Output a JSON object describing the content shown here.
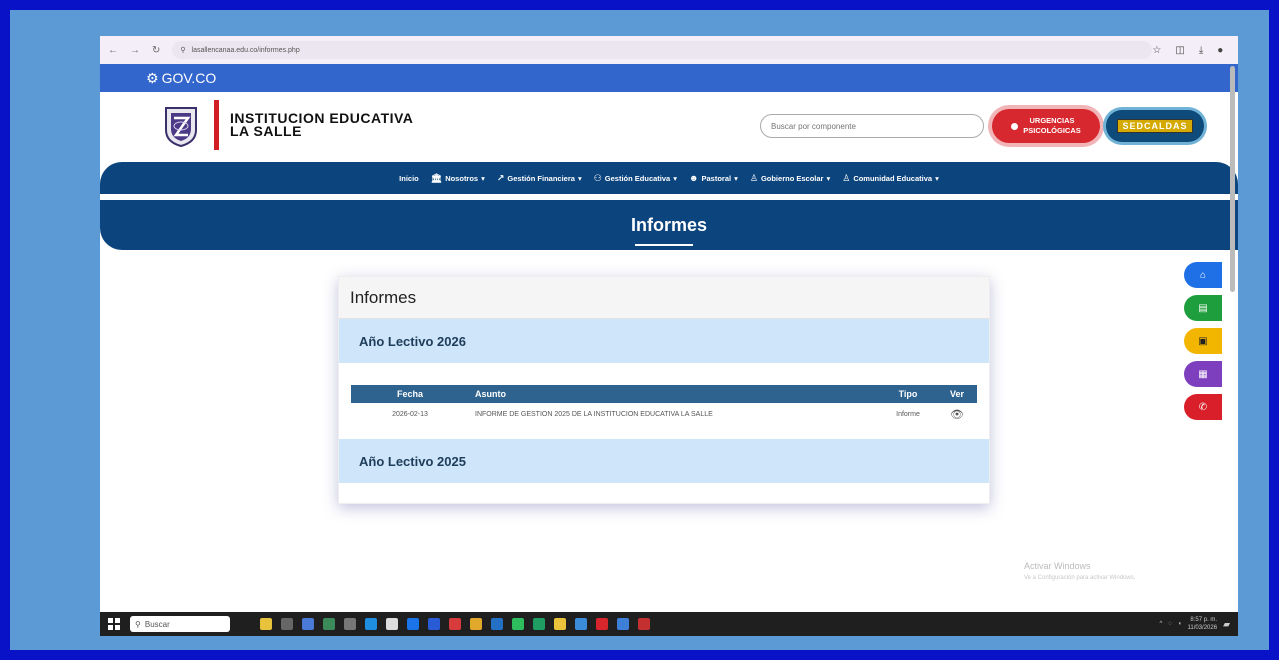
{
  "browser": {
    "url": "lasallencanaa.edu.co/informes.php",
    "nav_icons": [
      "back-icon",
      "forward-icon",
      "reload-icon"
    ],
    "tool_icons": [
      "star-icon",
      "extensions-icon",
      "download-icon",
      "profile-icon",
      "menu-icon"
    ]
  },
  "gov": {
    "label": "GOV.CO"
  },
  "header": {
    "institution_line1": "INSTITUCION EDUCATIVA",
    "institution_line2": "LA SALLE",
    "search_placeholder": "Buscar por componente",
    "urgencias_line1": "URGENCIAS",
    "urgencias_line2": "PSICOLÓGICAS",
    "sed_label": "SEDCALDAS"
  },
  "menu": [
    {
      "label": "Inicio",
      "icon": "",
      "dropdown": false
    },
    {
      "label": "Nosotros",
      "icon": "institution-icon",
      "dropdown": true
    },
    {
      "label": "Gestión Financiera",
      "icon": "chart-icon",
      "dropdown": true
    },
    {
      "label": "Gestión Educativa",
      "icon": "users-icon",
      "dropdown": true
    },
    {
      "label": "Pastoral",
      "icon": "people-icon",
      "dropdown": true
    },
    {
      "label": "Gobierno Escolar",
      "icon": "user-tie-icon",
      "dropdown": true
    },
    {
      "label": "Comunidad Educativa",
      "icon": "user-tie-icon",
      "dropdown": true
    }
  ],
  "page": {
    "title": "Informes"
  },
  "card": {
    "title": "Informes",
    "year_2026": "Año Lectivo 2026",
    "year_2025": "Año Lectivo 2025",
    "columns": {
      "fecha": "Fecha",
      "asunto": "Asunto",
      "tipo": "Tipo",
      "ver": "Ver"
    },
    "rows": [
      {
        "fecha": "2026-02-13",
        "asunto": "INFORME DE GESTION 2025 DE LA INSTITUCION EDUCATIVA LA SALLE",
        "tipo": "Informe",
        "ver_icon": "eye-icon"
      }
    ]
  },
  "side_buttons": [
    {
      "icon": "home-icon",
      "color": "#1f6fe6"
    },
    {
      "icon": "book-icon",
      "color": "#1e9e3c"
    },
    {
      "icon": "briefcase-icon",
      "color": "#f2b600"
    },
    {
      "icon": "image-icon",
      "color": "#7e3fbe"
    },
    {
      "icon": "phone-icon",
      "color": "#d9202a"
    }
  ],
  "watermark": {
    "line1": "Activar Windows",
    "line2": "Ve a Configuración para activar Windows."
  },
  "taskbar": {
    "search_label": "Buscar",
    "time": "8:57 p. m.",
    "date": "11/03/2026"
  },
  "colors": {
    "brand_blue": "#0c447d",
    "gov_blue": "#3366cc",
    "accent_red": "#d21f26",
    "year_bg": "#cfe5f9",
    "table_header": "#2e6390"
  }
}
